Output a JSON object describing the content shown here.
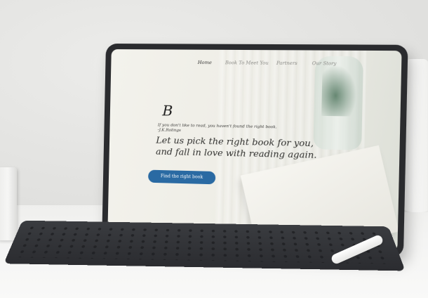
{
  "tablet_site": {
    "nav": {
      "items": [
        "Home",
        "Book To Meet You",
        "Partners",
        "Our Story"
      ]
    },
    "logo_letter": "B",
    "quote": {
      "line1": "If you don't like to read, you haven't found the right book.",
      "line2": "-J.K.Rolings"
    },
    "headline": {
      "line1": "Let us pick the right book for you,",
      "line2": "and fall in love with reading again."
    },
    "cta_label": "Find the right book",
    "colors": {
      "cta_bg": "#2a6aa3",
      "cta_text": "#ffffff"
    }
  }
}
